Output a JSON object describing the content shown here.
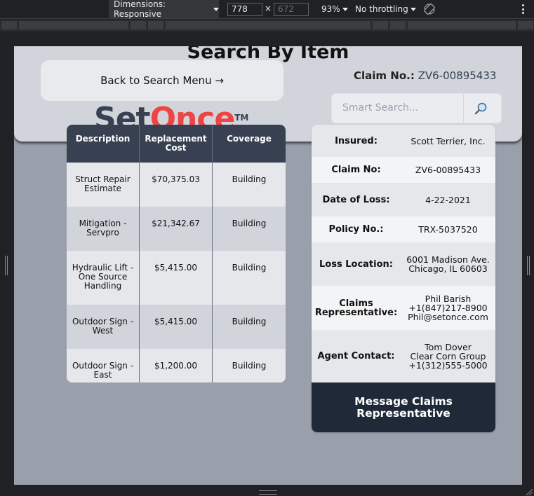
{
  "devtools": {
    "dimensions_label": "Dimensions: Responsive",
    "width_value": "778",
    "height_placeholder": "672",
    "times": "×",
    "zoom": "93%",
    "throttling": "No throttling"
  },
  "page": {
    "title": "Search By Item",
    "back_label": "Back to Search Menu →",
    "claim_label": "Claim No.:",
    "claim_value": "ZV6-00895433",
    "search_placeholder": "Smart Search...",
    "search_glyph": "🔎",
    "logo": {
      "part1": "Set",
      "part2": "Once",
      "tm": "TM"
    }
  },
  "items_table": {
    "headers": [
      "Description",
      "Replacement Cost",
      "Coverage"
    ],
    "rows": [
      {
        "description": "Struct Repair Estimate",
        "cost": "$70,375.03",
        "coverage": "Building"
      },
      {
        "description": "Mitigation - Servpro",
        "cost": "$21,342.67",
        "coverage": "Building"
      },
      {
        "description": "Hydraulic Lift - One Source Handling",
        "cost": "$5,415.00",
        "coverage": "Building"
      },
      {
        "description": "Outdoor Sign - West",
        "cost": "$5,415.00",
        "coverage": "Building"
      },
      {
        "description": "Outdoor Sign - East",
        "cost": "$1,200.00",
        "coverage": "Building"
      }
    ]
  },
  "details": {
    "insured_label": "Insured:",
    "insured_value": "Scott Terrier, Inc.",
    "claim_no_label": "Claim No:",
    "claim_no_value": "ZV6-00895433",
    "dol_label": "Date of Loss:",
    "dol_value": "4-22-2021",
    "policy_label": "Policy No.:",
    "policy_value": "TRX-5037520",
    "location_label": "Loss Location:",
    "location_line1": "6001 Madison Ave.",
    "location_line2": "Chicago, IL 60603",
    "rep_label_1": "Claims",
    "rep_label_2": "Representative:",
    "rep_name": "Phil Barish",
    "rep_phone": "+1(847)217-8900",
    "rep_email": "Phil@setonce.com",
    "agent_label": "Agent Contact:",
    "agent_name": "Tom Dover",
    "agent_company": "Clear Corn Group",
    "agent_phone": "+1(312)555-5000",
    "message_btn_1": "Message Claims",
    "message_btn_2": "Representative"
  }
}
